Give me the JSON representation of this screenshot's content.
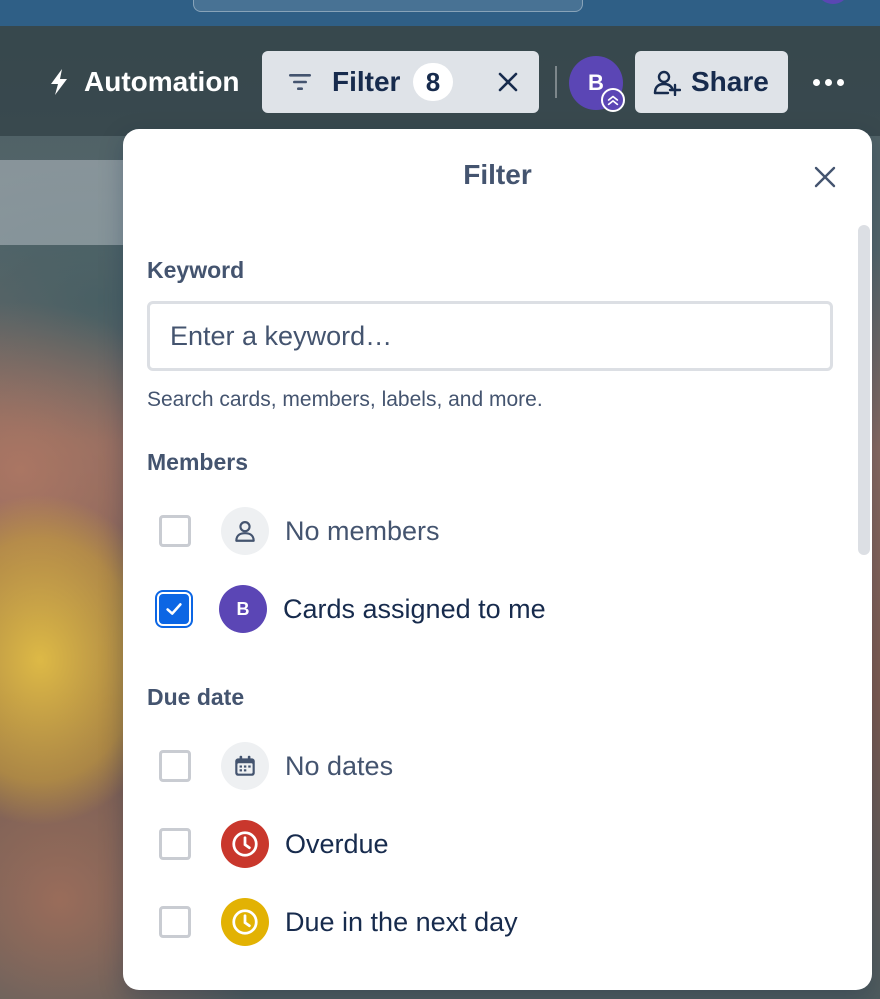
{
  "header": {
    "automation_label": "Automation",
    "filter_label": "Filter",
    "filter_count": "8",
    "member_initial": "B",
    "share_label": "Share"
  },
  "filter_panel": {
    "title": "Filter",
    "keyword": {
      "label": "Keyword",
      "placeholder": "Enter a keyword…",
      "value": "",
      "helper": "Search cards, members, labels, and more."
    },
    "members": {
      "label": "Members",
      "options": [
        {
          "label": "No members",
          "checked": false,
          "icon": "person-icon"
        },
        {
          "label": "Cards assigned to me",
          "checked": true,
          "icon": "avatar",
          "initial": "B"
        }
      ]
    },
    "due_date": {
      "label": "Due date",
      "options": [
        {
          "label": "No dates",
          "checked": false,
          "icon": "calendar-icon"
        },
        {
          "label": "Overdue",
          "checked": false,
          "icon": "clock-icon",
          "color": "#c9372c"
        },
        {
          "label": "Due in the next day",
          "checked": false,
          "icon": "clock-icon",
          "color": "#e2b203"
        }
      ]
    }
  },
  "colors": {
    "accent": "#0c66e4",
    "avatar": "#5b46b5",
    "overdue": "#c9372c",
    "due_soon": "#e2b203",
    "text": "#172b4d",
    "subtle_text": "#44546f"
  }
}
